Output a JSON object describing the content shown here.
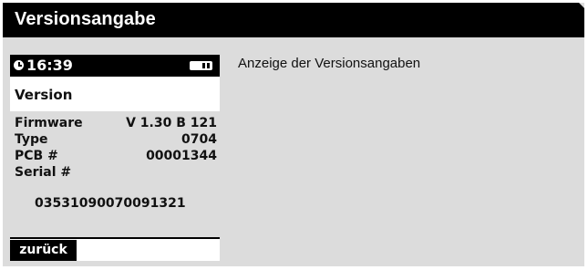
{
  "header": {
    "title": "Versionsangabe"
  },
  "device": {
    "status_bar": {
      "time": "16:39",
      "clock_icon": "clock-icon",
      "battery_icon": "battery-icon"
    },
    "screen_title": "Version",
    "info": {
      "firmware": {
        "label": "Firmware",
        "value": "V 1.30 B 121"
      },
      "type": {
        "label": "Type",
        "value": "0704"
      },
      "pcb": {
        "label": "PCB #",
        "value": "00001344"
      },
      "serial": {
        "label": "Serial #",
        "value": "03531090070091321"
      }
    },
    "softkey": {
      "back_label": "zurück"
    }
  },
  "description": "Anzeige der Versionsangaben",
  "colors": {
    "header_bg": "#000000",
    "panel_bg": "#dcdcdc",
    "screen_bg": "#ffffff"
  }
}
